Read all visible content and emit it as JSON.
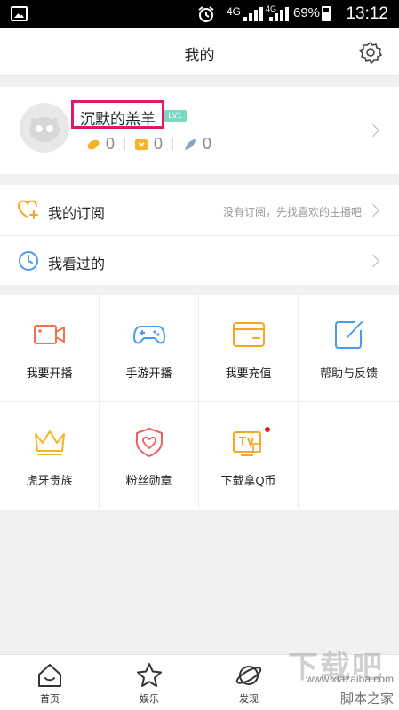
{
  "status_bar": {
    "network_1": "4G",
    "network_2": "4G",
    "network_3": "2G",
    "battery": "69%",
    "time": "13:12"
  },
  "header": {
    "title": "我的"
  },
  "profile": {
    "username": "沉默的羔羊",
    "level": "LV1",
    "stats": [
      {
        "icon": "seed-icon",
        "value": "0"
      },
      {
        "icon": "ticket-icon",
        "value": "0"
      },
      {
        "icon": "feather-icon",
        "value": "0"
      }
    ]
  },
  "list": [
    {
      "icon": "heart-plus-icon",
      "label": "我的订阅",
      "hint": "没有订阅，先找喜欢的主播吧"
    },
    {
      "icon": "clock-icon",
      "label": "我看过的",
      "hint": ""
    }
  ],
  "grid": [
    {
      "icon": "video-camera-icon",
      "label": "我要开播"
    },
    {
      "icon": "gamepad-icon",
      "label": "手游开播"
    },
    {
      "icon": "wallet-icon",
      "label": "我要充值"
    },
    {
      "icon": "edit-icon",
      "label": "帮助与反馈"
    },
    {
      "icon": "crown-icon",
      "label": "虎牙贵族"
    },
    {
      "icon": "heart-shield-icon",
      "label": "粉丝勋章"
    },
    {
      "icon": "tv-icon",
      "label": "下载拿Q币"
    }
  ],
  "tabbar": [
    {
      "icon": "home-icon",
      "label": "首页"
    },
    {
      "icon": "star-icon",
      "label": "娱乐"
    },
    {
      "icon": "planet-icon",
      "label": "发现"
    }
  ],
  "watermark": {
    "main": "下载吧",
    "url": "www.xiazaiba.com",
    "sub": "脚本之家"
  },
  "colors": {
    "highlight_box": "#e0176a",
    "accent_orange": "#f5a623",
    "accent_blue": "#4a9bf0",
    "accent_red": "#f06060",
    "level_badge": "#7cd8c2"
  }
}
